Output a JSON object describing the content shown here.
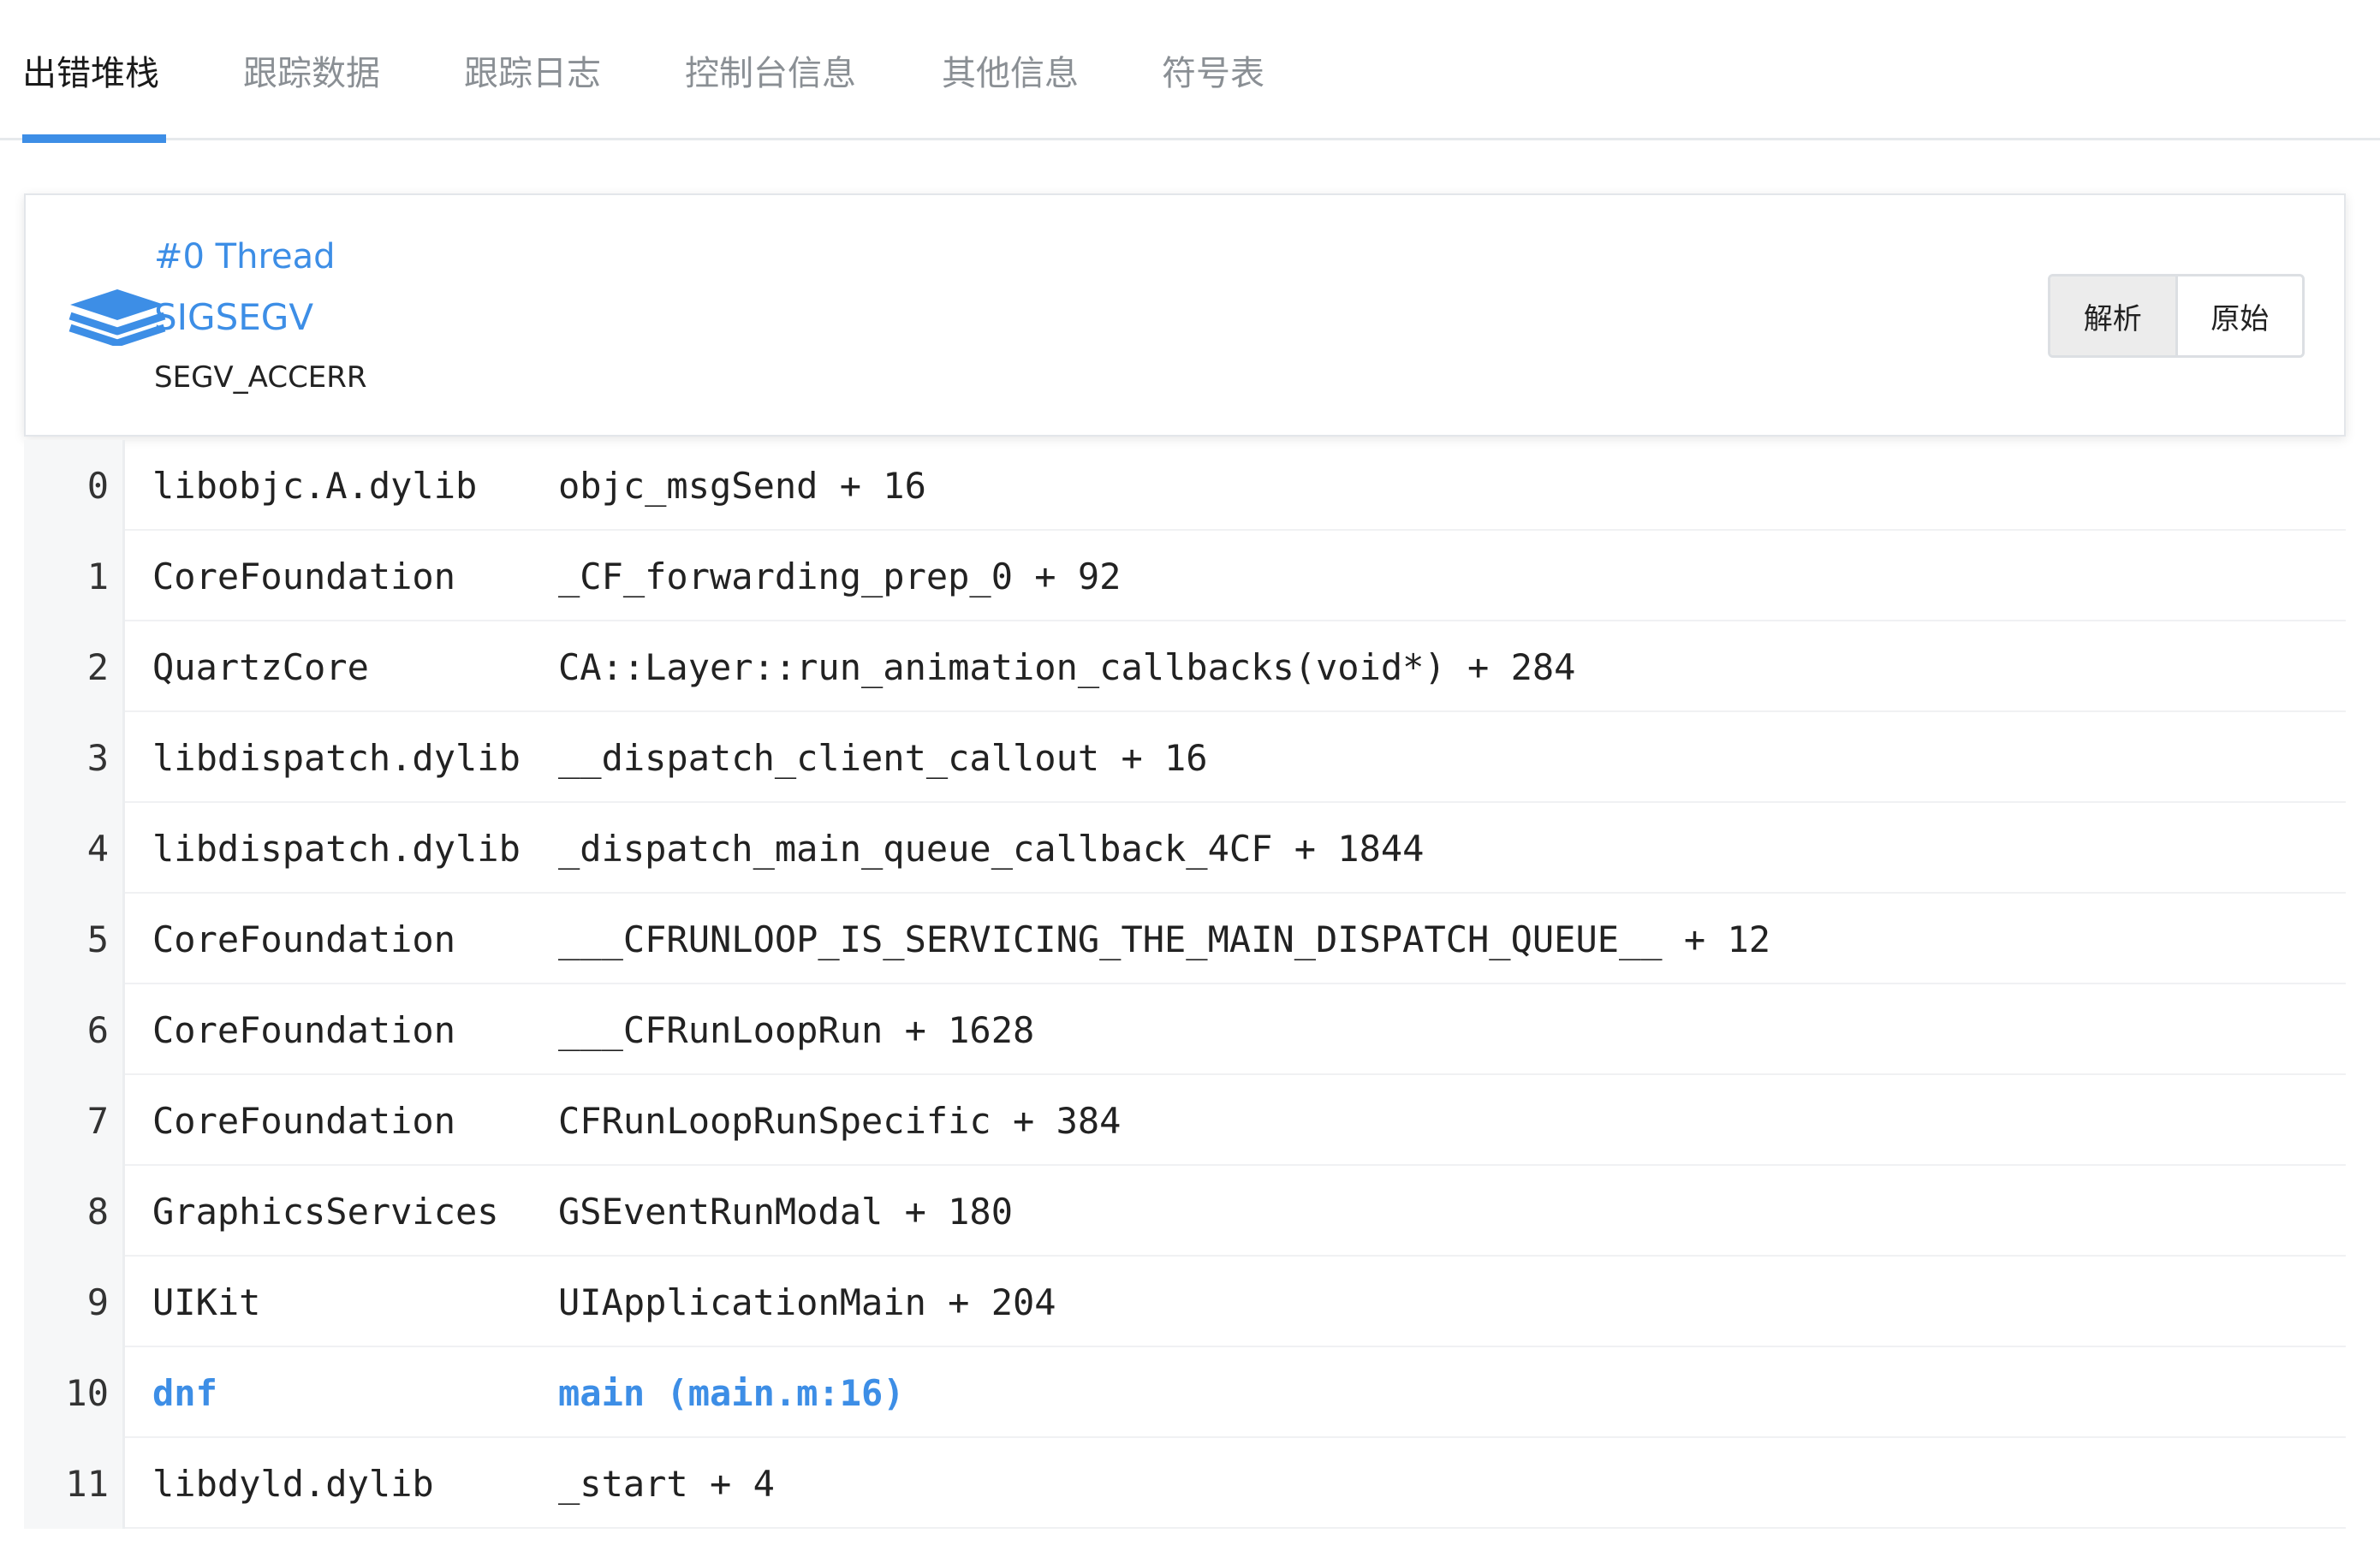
{
  "colors": {
    "accent": "#3d8ee6",
    "tab_inactive": "#8a8f94",
    "text": "#222222"
  },
  "tabs": [
    {
      "label": "出错堆栈",
      "active": true
    },
    {
      "label": "跟踪数据",
      "active": false
    },
    {
      "label": "跟踪日志",
      "active": false
    },
    {
      "label": "控制台信息",
      "active": false
    },
    {
      "label": "其他信息",
      "active": false
    },
    {
      "label": "符号表",
      "active": false
    }
  ],
  "thread": {
    "icon": "layers-icon",
    "title": "#0 Thread",
    "signal": "SIGSEGV",
    "code": "SEGV_ACCERR",
    "buttons": {
      "parse_label": "解析",
      "raw_label": "原始",
      "selected": "解析"
    }
  },
  "frames": [
    {
      "index": "0",
      "module": "libobjc.A.dylib",
      "symbol": "objc_msgSend + 16"
    },
    {
      "index": "1",
      "module": "CoreFoundation",
      "symbol": "_CF_forwarding_prep_0 + 92"
    },
    {
      "index": "2",
      "module": "QuartzCore",
      "symbol": "CA::Layer::run_animation_callbacks(void*) + 284"
    },
    {
      "index": "3",
      "module": "libdispatch.dylib",
      "symbol": "__dispatch_client_callout + 16"
    },
    {
      "index": "4",
      "module": "libdispatch.dylib",
      "symbol": "_dispatch_main_queue_callback_4CF + 1844"
    },
    {
      "index": "5",
      "module": "CoreFoundation",
      "symbol": "___CFRUNLOOP_IS_SERVICING_THE_MAIN_DISPATCH_QUEUE__ + 12"
    },
    {
      "index": "6",
      "module": "CoreFoundation",
      "symbol": "___CFRunLoopRun + 1628"
    },
    {
      "index": "7",
      "module": "CoreFoundation",
      "symbol": "CFRunLoopRunSpecific + 384"
    },
    {
      "index": "8",
      "module": "GraphicsServices",
      "symbol": "GSEventRunModal + 180"
    },
    {
      "index": "9",
      "module": "UIKit",
      "symbol": "UIApplicationMain + 204"
    },
    {
      "index": "10",
      "module": "dnf",
      "symbol": "main (main.m:16)",
      "highlight": true
    },
    {
      "index": "11",
      "module": "libdyld.dylib",
      "symbol": "_start + 4"
    }
  ]
}
